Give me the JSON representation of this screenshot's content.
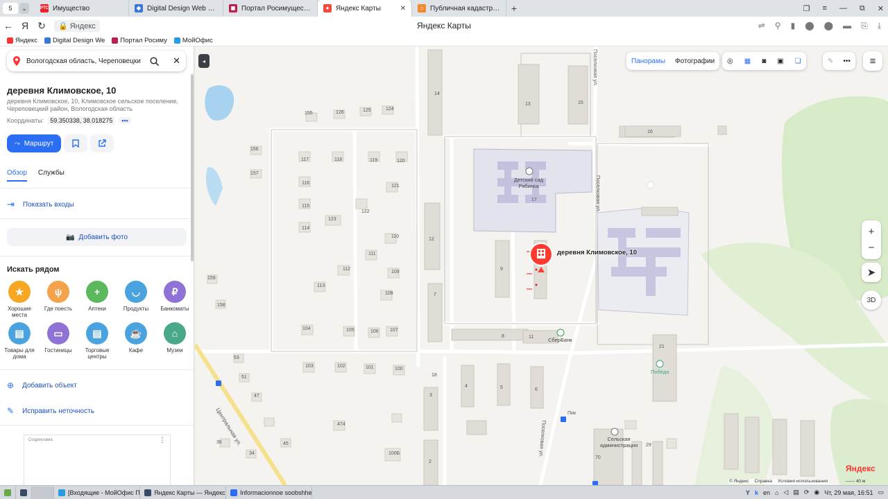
{
  "browser": {
    "tab_counter": "5",
    "tabs": [
      {
        "label": "Имущество",
        "fav": "РТС",
        "color": "#e8242b"
      },
      {
        "label": "Digital Design Web Client",
        "fav": "◆",
        "color": "#3a78d6"
      },
      {
        "label": "Портал Росимущества",
        "fav": "◼",
        "color": "#b8204e"
      },
      {
        "label": "Яндекс Карты",
        "fav": "●",
        "color": "#f04a3b",
        "active": true
      },
      {
        "label": "Публичная кадастровая",
        "fav": "⌂",
        "color": "#f08a2a"
      }
    ],
    "address_host": "Яндекс",
    "page_title": "Яндекс Карты",
    "bookmarks": [
      {
        "label": "Яндекс",
        "color": "#f33"
      },
      {
        "label": "Digital Design We",
        "color": "#3a78d6"
      },
      {
        "label": "Портал Росиму",
        "color": "#b8204e"
      },
      {
        "label": "МойОфис",
        "color": "#2b9be0"
      }
    ]
  },
  "panel": {
    "search_value": "Вологодская область, Череповецки",
    "title": "деревня Климовское, 10",
    "address": "деревня Климовское, 10, Климовское сельское поселение, Череповецкий район, Вологодская область",
    "coords_label": "Координаты:",
    "coords_value": "59.350338, 38.018275",
    "coords_more": "•••",
    "route_label": "Маршрут",
    "tab_overview": "Обзор",
    "tab_services": "Службы",
    "show_entrances": "Показать входы",
    "add_photo": "Добавить фото",
    "nearby_title": "Искать рядом",
    "categories": [
      {
        "label": "Хорошие места",
        "color": "#f5a623",
        "glyph": "★"
      },
      {
        "label": "Где поесть",
        "color": "#f4a24b",
        "glyph": "ψ"
      },
      {
        "label": "Аптеки",
        "color": "#5cb85c",
        "glyph": "+"
      },
      {
        "label": "Продукты",
        "color": "#4aa3df",
        "glyph": "◡"
      },
      {
        "label": "Банкоматы",
        "color": "#8e72d6",
        "glyph": "₽"
      },
      {
        "label": "Товары для дома",
        "color": "#4aa3df",
        "glyph": "▤"
      },
      {
        "label": "Гостиницы",
        "color": "#8e72d6",
        "glyph": "▭"
      },
      {
        "label": "Торговые центры",
        "color": "#4aa3df",
        "glyph": "▤"
      },
      {
        "label": "Кафе",
        "color": "#4aa3df",
        "glyph": "☕"
      },
      {
        "label": "Музеи",
        "color": "#4aa88a",
        "glyph": "⌂"
      }
    ],
    "add_object": "Добавить объект",
    "fix_error": "Исправить неточность",
    "ad_label": "Соцреклама"
  },
  "map": {
    "toolbar_panoramas": "Панорамы",
    "toolbar_photos": "Фотографии",
    "marker_label": "деревня Климовское, 10",
    "zoom_in": "+",
    "zoom_out": "−",
    "btn_3d": "3D",
    "logo": "Яндекс",
    "copyright": "© Яндекс",
    "help": "Справка",
    "terms": "Условия использования",
    "scale": "40 м",
    "labels": {
      "kindergarten": "Детский сад Рябинка",
      "sberbank": "СберБанк",
      "pobeda": "Победа",
      "admin": "Сельская администрация",
      "street_central": "Центральная ул.",
      "street_poselkovaya1": "Поселковая ул.",
      "street_poselkovaya2": "Поселковая ул.",
      "street_poselkovaya3": "Поселковая ул."
    },
    "house_numbers": [
      "14",
      "13",
      "15",
      "16",
      "155",
      "126",
      "125",
      "124",
      "156",
      "157",
      "117",
      "118",
      "119",
      "120",
      "121",
      "116",
      "122",
      "115",
      "123",
      "114",
      "110",
      "111",
      "112",
      "109",
      "113",
      "108",
      "159",
      "158",
      "104",
      "105",
      "106",
      "107",
      "103",
      "102",
      "101",
      "100",
      "53",
      "51",
      "47",
      "474",
      "45",
      "36",
      "34",
      "100Б",
      "12",
      "9",
      "7",
      "8",
      "11",
      "17",
      "18",
      "4",
      "5",
      "6",
      "3",
      "2",
      "21",
      "29",
      "70",
      "Пик"
    ]
  },
  "taskbar": {
    "items": [
      {
        "label": "[Входящие - МойОфис П...",
        "color": "#2b9be0"
      },
      {
        "label": "Яндекс Карты — Яндекс ...",
        "color": "#3a4b66"
      },
      {
        "label": "Informacionnoe soobshhe...",
        "color": "#2b6ef3"
      }
    ],
    "lang": "en",
    "clock": "Чт, 29 мая, 16:51"
  }
}
